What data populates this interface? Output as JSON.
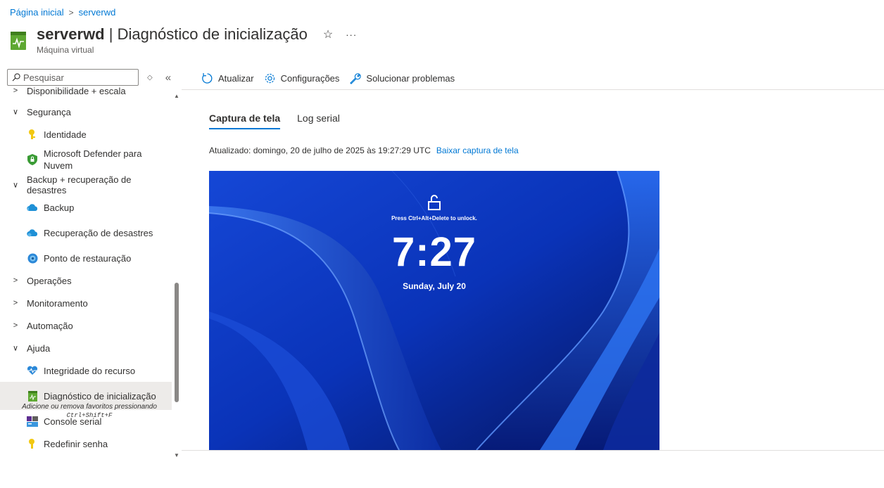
{
  "breadcrumb": {
    "home": "Página inicial",
    "resource": "serverwd"
  },
  "header": {
    "resource_name": "serverwd",
    "separator": " | ",
    "blade_title": "Diagnóstico de inicialização",
    "subtitle": "Máquina virtual"
  },
  "sidebar": {
    "search_placeholder": "Pesquisar",
    "items": [
      {
        "label": "Disponibilidade + escala"
      },
      {
        "label": "Segurança"
      },
      {
        "label": "Identidade"
      },
      {
        "label": "Microsoft Defender para Nuvem"
      },
      {
        "label": "Backup + recuperação de desastres"
      },
      {
        "label": "Backup"
      },
      {
        "label": "Recuperação de desastres"
      },
      {
        "label": "Ponto de restauração"
      },
      {
        "label": "Operações"
      },
      {
        "label": "Monitoramento"
      },
      {
        "label": "Automação"
      },
      {
        "label": "Ajuda"
      },
      {
        "label": "Integridade do recurso"
      },
      {
        "label": "Diagnóstico de inicialização"
      },
      {
        "label": "Console serial"
      },
      {
        "label": "Redefinir senha"
      }
    ],
    "favorites_hint": "Adicione ou remova favoritos pressionando",
    "favorites_shortcut": "Ctrl+Shift+F"
  },
  "toolbar": {
    "refresh": "Atualizar",
    "settings": "Configurações",
    "troubleshoot": "Solucionar problemas"
  },
  "tabs": [
    {
      "label": "Captura de tela"
    },
    {
      "label": "Log serial"
    }
  ],
  "status": {
    "updated": "Atualizado: domingo, 20 de julho de 2025 às 19:27:29 UTC",
    "download": "Baixar captura de tela"
  },
  "screenshot": {
    "hint": "Press Ctrl+Alt+Delete to unlock.",
    "time": "7:27",
    "date": "Sunday, July 20"
  },
  "colors": {
    "accent": "#0078d4",
    "selected_bg": "#edebe9",
    "wallpaper": "#0a2ea8"
  }
}
